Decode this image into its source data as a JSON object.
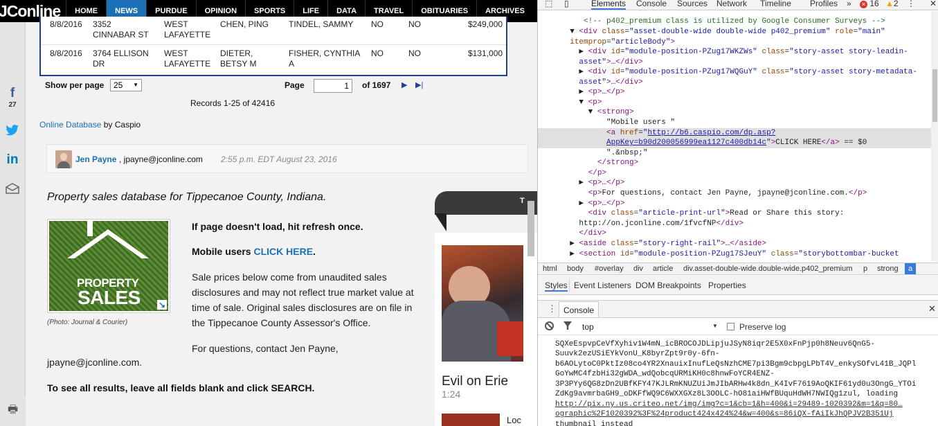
{
  "site": {
    "logo": "JConline",
    "nav": [
      "HOME",
      "NEWS",
      "PURDUE",
      "OPINION",
      "SPORTS",
      "LIFE",
      "DATA",
      "TRAVEL",
      "OBITUARIES",
      "ARCHIVES"
    ],
    "active_nav": "NEWS",
    "share": {
      "facebook_icon": "f",
      "facebook_count": "27",
      "twitter_icon": "twitter-icon",
      "linkedin_icon": "in",
      "email_icon": "envelope-icon",
      "print_icon": "printer-icon"
    },
    "table_rows": [
      [
        "8/8/2016",
        "3352 CINNABAR ST",
        "WEST LAFAYETTE",
        "CHEN, PING",
        "TINDEL, SAMMY",
        "NO",
        "NO",
        "$249,000"
      ],
      [
        "8/8/2016",
        "3764 ELLISON DR",
        "WEST LAFAYETTE",
        "DIETER, BETSY M",
        "FISHER, CYNTHIA A",
        "NO",
        "NO",
        "$131,000"
      ]
    ],
    "pager": {
      "per_page_label": "Show per page",
      "per_page_value": "25",
      "page_label": "Page",
      "page_value": "1",
      "of_label": "of 1697",
      "next_icon": "▶",
      "last_icon": "▶|",
      "records": "Records 1-25 of 42416"
    },
    "db_link": "Online Database",
    "db_by": "by Caspio",
    "byline": {
      "name": "Jen Payne",
      "email": ", jpayne@jconline.com",
      "time": "2:55 p.m. EDT August 23, 2016"
    },
    "headline": "Property sales database for Tippecanoe County, Indiana.",
    "image": {
      "line1": "PROPERTY",
      "line2": "SALES",
      "credit": "(Photo: Journal & Courier)"
    },
    "para_refresh": "If page doesn't load, hit refresh once.",
    "para_mobile_prefix": "Mobile users ",
    "para_mobile_link": "CLICK HERE",
    "para_mobile_suffix": ".",
    "para_disclaimer": "Sale prices below come from unaudited sales disclosures and may not reflect true market value at time of sale. Original sales disclosures are on file in the Tippecanoe County Assessor's Office.",
    "para_contact_1": "For questions, contact Jen Payne,",
    "para_contact_2": "jpayne@jconline.com.",
    "para_seeall": "To see all results, leave all fields blank and click SEARCH.",
    "rail": {
      "title": "T",
      "video_title": "Evil on Erie",
      "video_duration": "1:24",
      "next_title": "Loc"
    }
  },
  "devtools": {
    "tabs": [
      "Elements",
      "Console",
      "Sources",
      "Network",
      "Timeline",
      "Profiles"
    ],
    "active_tab": "Elements",
    "errors": "16",
    "warnings": "2",
    "breadcrumbs": [
      "html",
      "body",
      "#overlay",
      "div",
      "article",
      "div.asset-double-wide.double-wide.p402_premium",
      "p",
      "strong",
      "a"
    ],
    "active_crumb": "a",
    "subtabs": [
      "Styles",
      "Event Listeners",
      "DOM Breakpoints",
      "Properties"
    ],
    "console_title": "Console",
    "console_context": "top",
    "preserve_log": "Preserve log",
    "console_lines": [
      "SQXeEspvpCeVfXyhiv1W4mN_icBROCOJDLipjuJSyN8iqr2E5X0xFnPjp0h8Neuv6QnG5-",
      "Suuvk2ezUSiEYkVonU_K8byrZpt9r0y-6fn-",
      "b6AOLytoC0PktIz08co4YR2XnauixInufLeQsNzhCME7pi3Bgm9cbpgLPbT4V_enkySOfvL41B_JQPl",
      "GoYwMC4fzbHi32gWDA_wdQobcqURMiKH0c8hnwFoYCR4ENZ-",
      "3P3PYy6QG8zDn2UBfKFY47KJLRmKNUZUiJmJIbARHw4k8dn_K4IvF7619AoQKIF61yd0u3OngG_YTOi",
      "ZdKg9avmrbaGH9_oDKFfWQ9C6WXXGXz8L3OOLC-hO81aiHWfBUquHdWH7NWIQg1zul, loading",
      "http://pix.ny.us.criteo.net/img/img?c=1&cb=1&h=400&i=29489-1020392&m=1&q=80…",
      "ographic%2F1020392%3F%24product424x424%24&w=400&s=86iQX-fAiIkJhQPJV2B351Uj",
      "thumbnail instead"
    ],
    "elements_lines": [
      {
        "t": "cmt",
        "indent": 6,
        "text": "<!-- p402_premium class is utilized by Google Consumer Surveys -->"
      },
      {
        "t": "div1",
        "indent": 5,
        "text": ""
      },
      {
        "t": "raw",
        "indent": 5,
        "text": "itemprop=\"articleBody\">"
      },
      {
        "t": "raw",
        "indent": 6,
        "text": "asset\">…</div>"
      },
      {
        "t": "raw",
        "indent": 6,
        "text": "asset\">…</div>"
      }
    ]
  }
}
